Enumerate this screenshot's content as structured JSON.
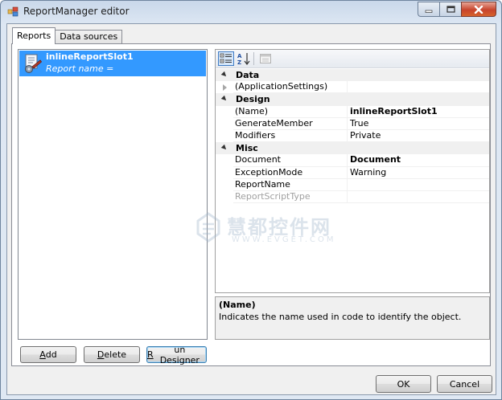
{
  "window": {
    "title": "ReportManager editor",
    "accent": "#3399ff"
  },
  "tabs": [
    {
      "label": "Reports",
      "active": true
    },
    {
      "label": "Data sources",
      "active": false
    }
  ],
  "reports": {
    "items": [
      {
        "title": "inlineReportSlot1",
        "subtitle": "Report name =",
        "icon": "report-designer-icon",
        "selected": true
      }
    ],
    "buttons": {
      "add_pre": "",
      "add_accel": "A",
      "add_post": "dd",
      "delete_pre": "",
      "delete_accel": "D",
      "delete_post": "elete",
      "run_pre": "",
      "run_accel": "R",
      "run_post": "un Designer"
    }
  },
  "property_grid": {
    "toolbar": {
      "categorized_icon": "categorized-icon",
      "alphabetical_icon": "alphabetical-sort-icon",
      "pages_icon": "property-pages-icon"
    },
    "rows": [
      {
        "kind": "category",
        "name": "Data"
      },
      {
        "kind": "property",
        "name": "(ApplicationSettings)",
        "value": "",
        "expandable": true
      },
      {
        "kind": "category",
        "name": "Design"
      },
      {
        "kind": "property",
        "name": "(Name)",
        "value": "inlineReportSlot1",
        "value_bold": true
      },
      {
        "kind": "property",
        "name": "GenerateMember",
        "value": "True"
      },
      {
        "kind": "property",
        "name": "Modifiers",
        "value": "Private"
      },
      {
        "kind": "category",
        "name": "Misc"
      },
      {
        "kind": "property",
        "name": "Document",
        "value": "Document",
        "value_bold": true
      },
      {
        "kind": "property",
        "name": "ExceptionMode",
        "value": "Warning"
      },
      {
        "kind": "property",
        "name": "ReportName",
        "value": ""
      },
      {
        "kind": "property",
        "name": "ReportScriptType",
        "value": "",
        "disabled": true
      }
    ],
    "help": {
      "title": "(Name)",
      "description": "Indicates the name used in code to identify the object."
    }
  },
  "footer": {
    "ok_label": "OK",
    "cancel_label": "Cancel"
  },
  "watermark": {
    "text": "慧都控件网",
    "url": "WWW.EVGET.COM"
  }
}
